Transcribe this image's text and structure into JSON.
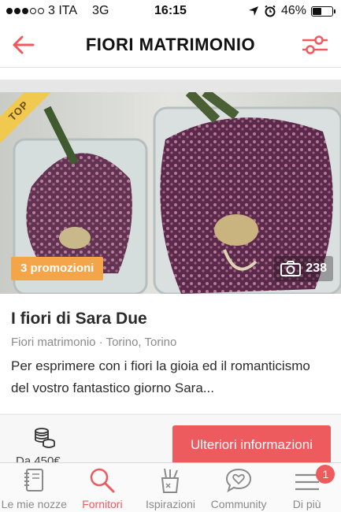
{
  "status_bar": {
    "carrier": "3 ITA",
    "network": "3G",
    "time": "16:15",
    "battery": "46%",
    "battery_level": 0.46
  },
  "header": {
    "title": "FIORI MATRIMONIO",
    "back_icon": "arrow-left-icon",
    "filter_icon": "sliders-icon"
  },
  "card": {
    "ribbon": "TOP",
    "promo": "3 promozioni",
    "photo_count": "238",
    "name": "I fiori di Sara Due",
    "meta": "Fiori matrimonio · Torino, Torino",
    "description": "Per esprimere con i fiori la gioia ed il romanticismo del vostro fantastico giorno Sara...",
    "price": "Da 450€",
    "more_info_label": "Ulteriori informazioni"
  },
  "tabs": [
    {
      "label": "Le mie nozze",
      "icon": "notebook-icon"
    },
    {
      "label": "Fornitori",
      "icon": "search-icon",
      "active": true
    },
    {
      "label": "Ispirazioni",
      "icon": "pencil-cup-icon"
    },
    {
      "label": "Community",
      "icon": "chat-heart-icon"
    },
    {
      "label": "Di più",
      "icon": "menu-icon",
      "badge": "1"
    }
  ],
  "colors": {
    "accent": "#ee5b5f",
    "promo": "#f4a54a",
    "ribbon": "#f1c94e"
  }
}
